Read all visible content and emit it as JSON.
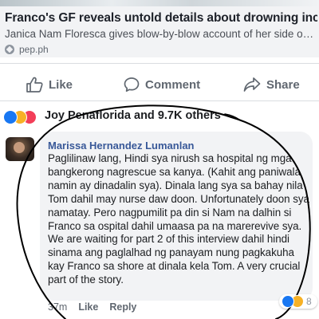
{
  "link_preview": {
    "title": "Franco's GF reveals untold details about drowning incident",
    "subtitle": "Janica Nam Floresca gives blow-by-blow account of her side of sto...",
    "source": "pep.ph",
    "source_icon": "compass-icon"
  },
  "actions": {
    "like": "Like",
    "comment": "Comment",
    "share": "Share"
  },
  "reactions": {
    "summary": "Joy Penaflorida and 9.7K others",
    "icons": [
      "like-reaction-icon",
      "sad-reaction-icon",
      "love-reaction-icon"
    ],
    "colors": {
      "like": "#1877f2",
      "sad": "#f7b125",
      "love": "#f33e58"
    }
  },
  "comment": {
    "author": "Marissa Hernandez Lumanlan",
    "body": "Paglilinaw lang, Hindi sya nirush sa hospital ng mga bangkerong nagrescue sa kanya. (Kahit ang paniwala namin ay dinadalin sya). Dinala lang sya sa bahay nila Tom dahil may nurse daw doon. Unfortunately doon sya namatay. Pero nagpumilit pa din si Nam na dalhin si Franco sa ospital dahil umaasa pa na marerevive sya. We are waiting for part 2 of this interview dahil hindi sinama ang paglalhad ng panayam nung pagkakuha kay Franco sa shore at dinala kela Tom. A very crucial part of the story.",
    "time": "37m",
    "like_link": "Like",
    "reply_link": "Reply",
    "reaction_count": "8",
    "reaction_icons": [
      "like-reaction-icon",
      "sad-reaction-icon"
    ]
  },
  "annotation": {
    "shape": "hand-drawn-circle",
    "color": "#000000"
  }
}
